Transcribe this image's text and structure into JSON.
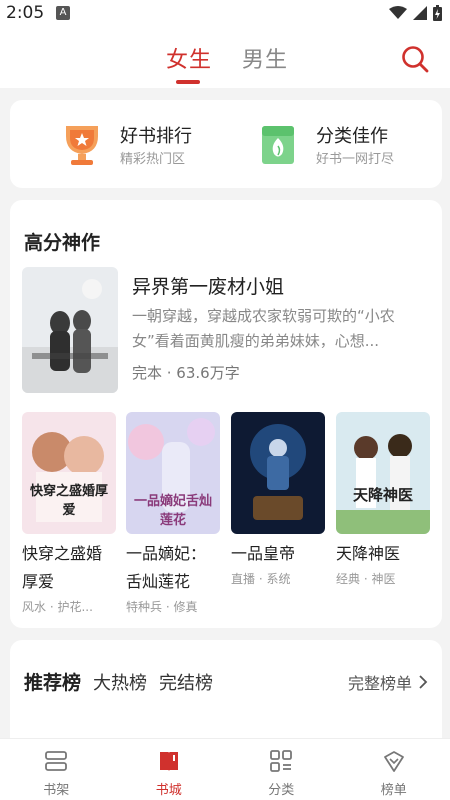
{
  "status_bar": {
    "time": "2:05",
    "notif_letter": "A"
  },
  "top_tabs": {
    "female": "女生",
    "male": "男生"
  },
  "quick_links": [
    {
      "title": "好书排行",
      "subtitle": "精彩热门区",
      "icon": "trophy-icon"
    },
    {
      "title": "分类佳作",
      "subtitle": "好书一网打尽",
      "icon": "category-icon"
    }
  ],
  "top_rated": {
    "title": "高分神作",
    "featured": {
      "title": "异界第一废材小姐",
      "description": "一朝穿越，穿越成农家软弱可欺的“小农女”看着面黄肌瘦的弟弟妹妹，心想...",
      "meta": "完本 · 63.6万字",
      "cover_text": ""
    },
    "books": [
      {
        "title": "快穿之盛婚厚爱",
        "tags": "风水 · 护花...",
        "cover_text": "快穿之盛婚厚爱"
      },
      {
        "title": "一品嫡妃：舌灿莲花",
        "tags": "特种兵 · 修真",
        "cover_text": "一品嫡妃舌灿莲花"
      },
      {
        "title": "一品皇帝",
        "tags": "直播 · 系统",
        "cover_text": ""
      },
      {
        "title": "天降神医",
        "tags": "经典 · 神医",
        "cover_text": "天降神医"
      }
    ]
  },
  "rank_lists": {
    "tabs": [
      "推荐榜",
      "大热榜",
      "完结榜"
    ],
    "full_list": "完整榜单"
  },
  "bottom_nav": [
    {
      "label": "书架",
      "icon": "bookshelf-icon"
    },
    {
      "label": "书城",
      "icon": "bookstore-icon"
    },
    {
      "label": "分类",
      "icon": "category-grid-icon"
    },
    {
      "label": "榜单",
      "icon": "ranking-icon"
    }
  ],
  "colors": {
    "accent": "#d0312d",
    "background": "#f3f3f3"
  }
}
